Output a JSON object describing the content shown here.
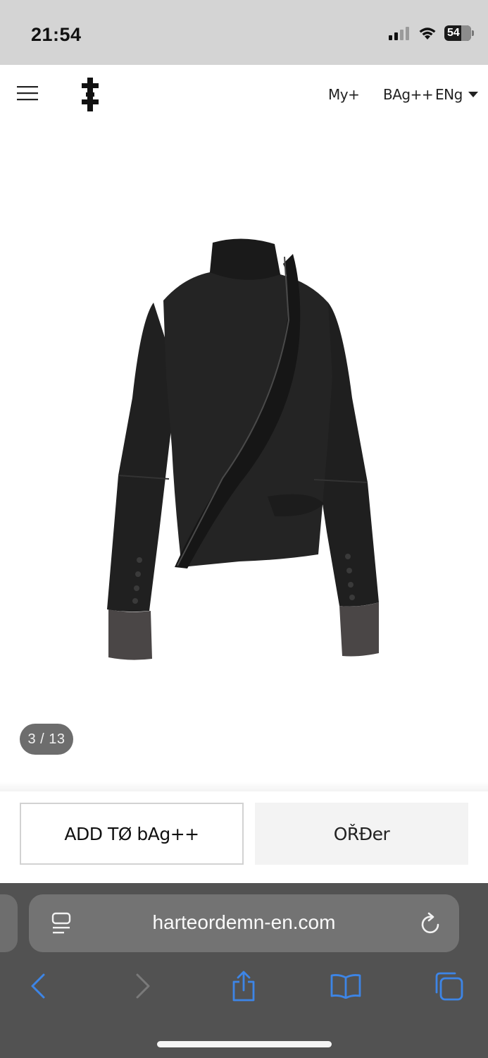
{
  "status_bar": {
    "time": "21:54",
    "battery": "54"
  },
  "header": {
    "my_label": "My+",
    "bag_label": "BAg++",
    "lang_label": "ENg"
  },
  "product": {
    "image_counter": "3 / 13"
  },
  "actions": {
    "add_to_bag_label": "ADD TØ bAg++",
    "order_label": "OŘĐer"
  },
  "browser": {
    "url": "harteordemn-en.com"
  },
  "colors": {
    "status_bar_bg": "#d4d4d4",
    "browser_bg": "#525252",
    "address_bar_bg": "#737373",
    "accent_blue": "#3d85e6",
    "counter_bg": "#6d6d6d"
  }
}
